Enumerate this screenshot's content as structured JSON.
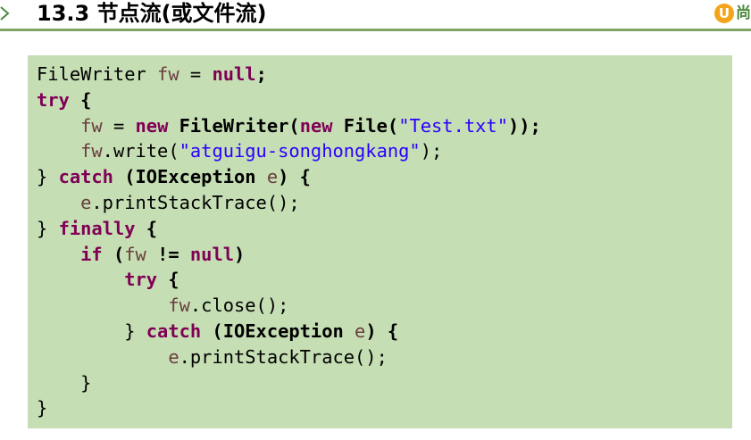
{
  "header": {
    "title": "13.3 节点流(或文件流)",
    "logo_text": "尚"
  },
  "code": {
    "lines": [
      [
        {
          "t": "FileWriter ",
          "c": "plain"
        },
        {
          "t": "fw",
          "c": "var"
        },
        {
          "t": " = ",
          "c": "plain"
        },
        {
          "t": "null",
          "c": "kw"
        },
        {
          "t": ";",
          "c": "b"
        }
      ],
      [
        {
          "t": "try",
          "c": "kw"
        },
        {
          "t": " {",
          "c": "b"
        }
      ],
      [
        {
          "t": "    ",
          "c": "plain"
        },
        {
          "t": "fw",
          "c": "var"
        },
        {
          "t": " = ",
          "c": "plain"
        },
        {
          "t": "new",
          "c": "kw"
        },
        {
          "t": " FileWriter(",
          "c": "b"
        },
        {
          "t": "new",
          "c": "kw"
        },
        {
          "t": " File(",
          "c": "b"
        },
        {
          "t": "\"Test.txt\"",
          "c": "str"
        },
        {
          "t": "));",
          "c": "b"
        }
      ],
      [
        {
          "t": "    ",
          "c": "plain"
        },
        {
          "t": "fw",
          "c": "var"
        },
        {
          "t": ".write(",
          "c": "plain"
        },
        {
          "t": "\"atguigu-songhongkang\"",
          "c": "str"
        },
        {
          "t": ");",
          "c": "plain"
        }
      ],
      [
        {
          "t": "} ",
          "c": "plain"
        },
        {
          "t": "catch",
          "c": "kw"
        },
        {
          "t": " (IOException ",
          "c": "b"
        },
        {
          "t": "e",
          "c": "var"
        },
        {
          "t": ") {",
          "c": "b"
        }
      ],
      [
        {
          "t": "    ",
          "c": "plain"
        },
        {
          "t": "e",
          "c": "var"
        },
        {
          "t": ".printStackTrace();",
          "c": "plain"
        }
      ],
      [
        {
          "t": "} ",
          "c": "plain"
        },
        {
          "t": "finally",
          "c": "kw"
        },
        {
          "t": " {",
          "c": "b"
        }
      ],
      [
        {
          "t": "    ",
          "c": "plain"
        },
        {
          "t": "if",
          "c": "kw"
        },
        {
          "t": " (",
          "c": "b"
        },
        {
          "t": "fw",
          "c": "var"
        },
        {
          "t": " != ",
          "c": "b"
        },
        {
          "t": "null",
          "c": "kw"
        },
        {
          "t": ")",
          "c": "b"
        }
      ],
      [
        {
          "t": "        ",
          "c": "plain"
        },
        {
          "t": "try",
          "c": "kw"
        },
        {
          "t": " {",
          "c": "b"
        }
      ],
      [
        {
          "t": "            ",
          "c": "plain"
        },
        {
          "t": "fw",
          "c": "var"
        },
        {
          "t": ".close();",
          "c": "plain"
        }
      ],
      [
        {
          "t": "        } ",
          "c": "plain"
        },
        {
          "t": "catch",
          "c": "kw"
        },
        {
          "t": " (IOException ",
          "c": "b"
        },
        {
          "t": "e",
          "c": "var"
        },
        {
          "t": ") {",
          "c": "b"
        }
      ],
      [
        {
          "t": "            ",
          "c": "plain"
        },
        {
          "t": "e",
          "c": "var"
        },
        {
          "t": ".printStackTrace();",
          "c": "plain"
        }
      ],
      [
        {
          "t": "    }",
          "c": "plain"
        }
      ],
      [
        {
          "t": "}",
          "c": "plain"
        }
      ]
    ]
  },
  "colors": {
    "code_background": "#c6deb4",
    "keyword": "#7f0055",
    "variable": "#6a3e3e",
    "string": "#2a00ff",
    "divider": "#7ea463"
  },
  "icons": {
    "bullet": "chevron-right-icon",
    "logo": "brand-logo-icon"
  }
}
